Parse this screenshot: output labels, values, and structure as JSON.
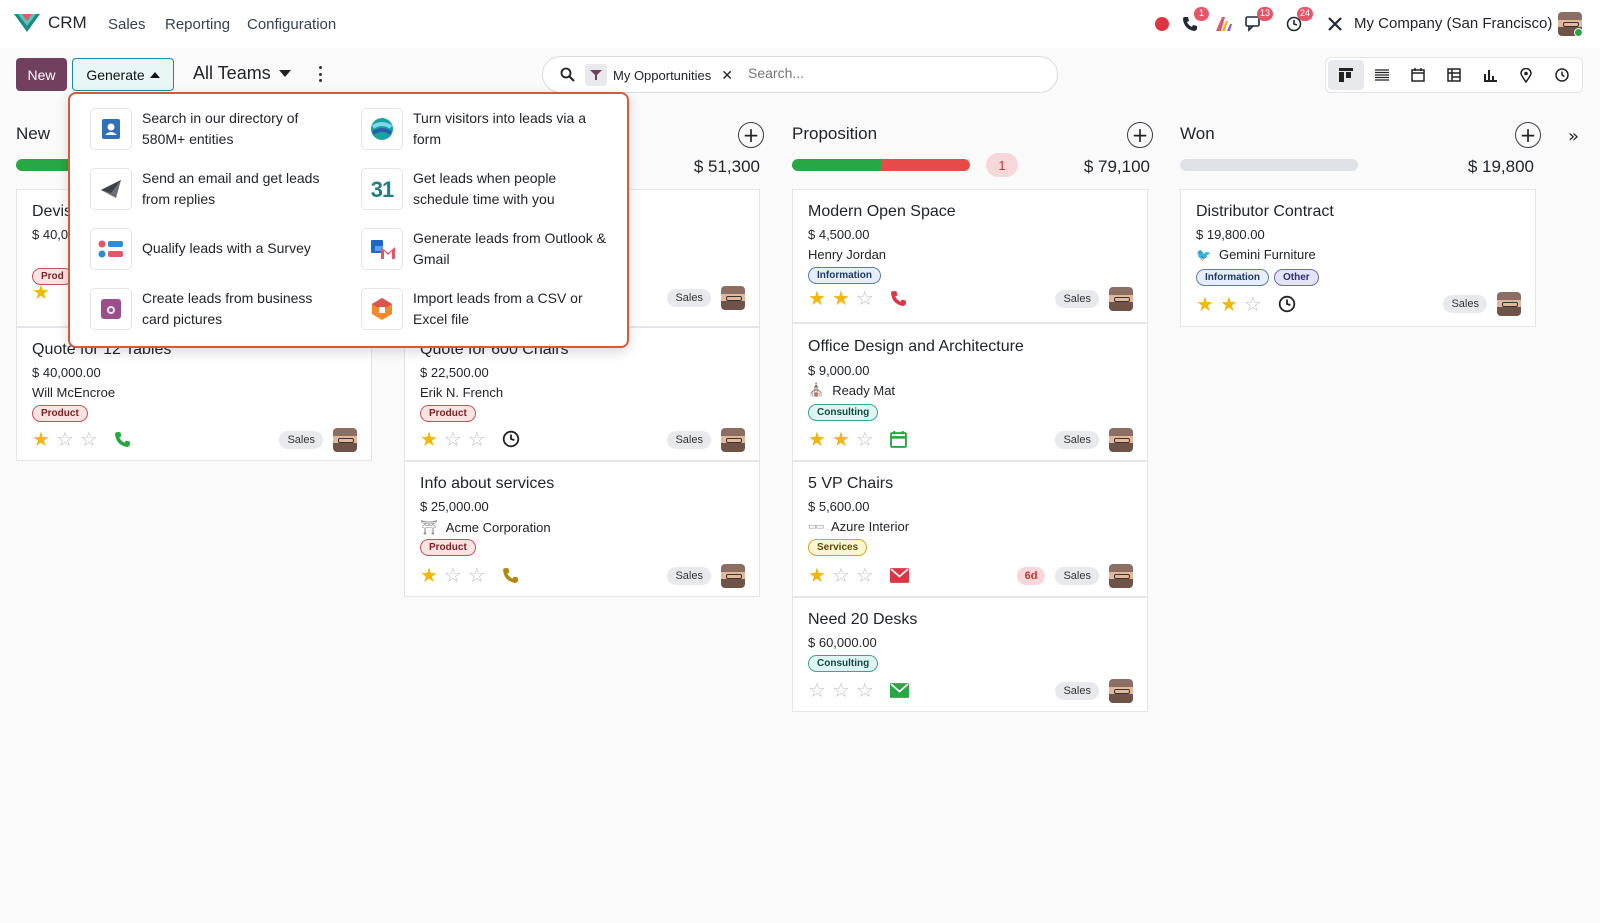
{
  "app": {
    "name": "CRM"
  },
  "nav": {
    "menus": [
      "Sales",
      "Reporting",
      "Configuration"
    ],
    "company": "My Company (San Francisco)",
    "badges": {
      "calls": "1",
      "messages": "13",
      "activities": "24"
    }
  },
  "toolbar": {
    "new_label": "New",
    "generate_label": "Generate",
    "teams_label": "All Teams"
  },
  "search": {
    "facet": "My Opportunities",
    "placeholder": "Search..."
  },
  "generate_menu": [
    {
      "text": "Search in our directory of 580M+ entities",
      "icon": "directory-icon"
    },
    {
      "text": "Turn visitors into leads via a form",
      "icon": "form-icon"
    },
    {
      "text": "Send an email and get leads from replies",
      "icon": "email-send-icon"
    },
    {
      "text": "Get leads when people schedule time with you",
      "icon": "calendar-appointment-icon"
    },
    {
      "text": "Qualify leads with a Survey",
      "icon": "survey-icon"
    },
    {
      "text": "Generate leads from Outlook & Gmail",
      "icon": "outlook-gmail-icon"
    },
    {
      "text": "Create leads from business card pictures",
      "icon": "business-card-icon"
    },
    {
      "text": "Import leads from a CSV or Excel file",
      "icon": "import-icon"
    }
  ],
  "columns": {
    "new": {
      "title": "New",
      "cards": [
        {
          "title": "Devis",
          "amount": "$ 40,0",
          "customer": "",
          "tag": "Prod"
        },
        {
          "title": "Quote for 12 Tables",
          "amount": "$ 40,000.00",
          "customer": "Will McEncroe",
          "tag": "Product",
          "team": "Sales"
        }
      ]
    },
    "qualified": {
      "total": "$ 51,300",
      "cards": [
        {
          "title": "",
          "team": "Sales"
        },
        {
          "title": "Quote for 600 Chairs",
          "amount": "$ 22,500.00",
          "customer": "Erik N. French",
          "tag": "Product",
          "team": "Sales"
        },
        {
          "title": "Info about services",
          "amount": "$ 25,000.00",
          "customer": "Acme Corporation",
          "tag": "Product",
          "team": "Sales"
        }
      ]
    },
    "proposition": {
      "title": "Proposition",
      "total": "$ 79,100",
      "count": "1",
      "cards": [
        {
          "title": "Modern Open Space",
          "amount": "$ 4,500.00",
          "customer": "Henry Jordan",
          "tag": "Information",
          "team": "Sales"
        },
        {
          "title": "Office Design and Architecture",
          "amount": "$ 9,000.00",
          "customer": "Ready Mat",
          "tag": "Consulting",
          "team": "Sales"
        },
        {
          "title": "5 VP Chairs",
          "amount": "$ 5,600.00",
          "customer": "Azure Interior",
          "tag": "Services",
          "team": "Sales",
          "overdue": "6d"
        },
        {
          "title": "Need 20 Desks",
          "amount": "$ 60,000.00",
          "tag": "Consulting",
          "team": "Sales"
        }
      ]
    },
    "won": {
      "title": "Won",
      "total": "$ 19,800",
      "cards": [
        {
          "title": "Distributor Contract",
          "amount": "$ 19,800.00",
          "customer": "Gemini Furniture",
          "tags": [
            "Information",
            "Other"
          ],
          "team": "Sales"
        }
      ]
    }
  }
}
